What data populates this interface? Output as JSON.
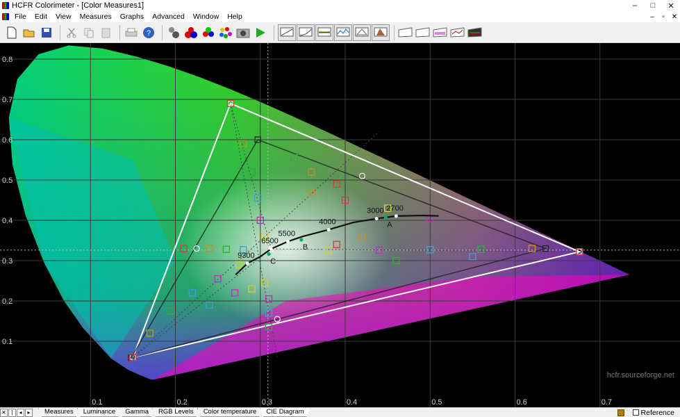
{
  "window": {
    "title": "HCFR Colorimeter - [Color Measures1]",
    "controls": [
      "–",
      "□",
      "✕"
    ],
    "mdi_controls": [
      "–",
      "▫",
      "✕"
    ]
  },
  "menu": [
    "File",
    "Edit",
    "View",
    "Measures",
    "Graphs",
    "Advanced",
    "Window",
    "Help"
  ],
  "toolbar": {
    "icons": [
      "new-icon",
      "open-icon",
      "save-icon",
      "cut-icon",
      "copy-icon",
      "paste-icon",
      "print-icon",
      "help-icon",
      "sensor-icon",
      "generator-icon",
      "rgb-balls-icon",
      "color-wheel-icon",
      "camera-icon",
      "play-icon",
      "graph-icons"
    ]
  },
  "tabs": [
    "Measures",
    "Luminance",
    "Gamma",
    "RGB Levels",
    "Color temperature",
    "CIE Diagram"
  ],
  "active_tab": "CIE Diagram",
  "reference_label": "Reference",
  "watermark": "hcfr.sourceforge.net",
  "chart_data": {
    "type": "scatter",
    "title": "",
    "xlabel": "",
    "ylabel": "",
    "xlim": [
      0.0,
      0.8
    ],
    "ylim": [
      0.0,
      0.87
    ],
    "grid": true,
    "x_ticks": [
      "0.1",
      "0.2",
      "0.3",
      "0.4",
      "0.5",
      "0.6",
      "0.7"
    ],
    "y_ticks": [
      "0.1",
      "0.2",
      "0.3",
      "0.4",
      "0.5",
      "0.6",
      "0.7",
      "0.8"
    ],
    "reference_gamut": [
      [
        0.676,
        0.322
      ],
      [
        0.265,
        0.69
      ],
      [
        0.15,
        0.06
      ]
    ],
    "measured_gamut": [
      [
        0.636,
        0.33
      ],
      [
        0.297,
        0.6
      ],
      [
        0.148,
        0.059
      ]
    ],
    "white_points": {
      "reference": [
        0.313,
        0.329
      ],
      "measured": [
        0.31,
        0.316
      ]
    },
    "blackbody_labels": [
      {
        "label": "2700",
        "x": 0.46,
        "y": 0.4106
      },
      {
        "label": "3000",
        "x": 0.4369,
        "y": 0.4041
      },
      {
        "label": "4000",
        "x": 0.3805,
        "y": 0.3768
      },
      {
        "label": "5500",
        "x": 0.3325,
        "y": 0.3475
      },
      {
        "label": "6500",
        "x": 0.3127,
        "y": 0.329
      },
      {
        "label": "9300",
        "x": 0.2848,
        "y": 0.2932
      }
    ],
    "illuminants": [
      {
        "label": "A",
        "x": 0.4476,
        "y": 0.4074
      },
      {
        "label": "B",
        "x": 0.3484,
        "y": 0.3516
      },
      {
        "label": "C",
        "x": 0.3101,
        "y": 0.3162
      }
    ],
    "saturation_points": [
      [
        0.676,
        0.322
      ],
      [
        0.62,
        0.33
      ],
      [
        0.56,
        0.328
      ],
      [
        0.5,
        0.327
      ],
      [
        0.44,
        0.326
      ],
      [
        0.38,
        0.325
      ],
      [
        0.265,
        0.69
      ],
      [
        0.28,
        0.59
      ],
      [
        0.29,
        0.52
      ],
      [
        0.297,
        0.455
      ],
      [
        0.3,
        0.4
      ],
      [
        0.305,
        0.36
      ],
      [
        0.15,
        0.06
      ],
      [
        0.17,
        0.12
      ],
      [
        0.195,
        0.175
      ],
      [
        0.22,
        0.22
      ],
      [
        0.25,
        0.255
      ],
      [
        0.275,
        0.29
      ],
      [
        0.21,
        0.33
      ],
      [
        0.24,
        0.33
      ],
      [
        0.26,
        0.328
      ],
      [
        0.28,
        0.327
      ],
      [
        0.5,
        0.405
      ],
      [
        0.45,
        0.43
      ],
      [
        0.4,
        0.45
      ],
      [
        0.36,
        0.47
      ],
      [
        0.31,
        0.135
      ],
      [
        0.31,
        0.17
      ],
      [
        0.31,
        0.205
      ],
      [
        0.305,
        0.245
      ],
      [
        0.39,
        0.49
      ],
      [
        0.36,
        0.52
      ],
      [
        0.34,
        0.555
      ],
      [
        0.24,
        0.19
      ],
      [
        0.27,
        0.22
      ],
      [
        0.29,
        0.23
      ],
      [
        0.39,
        0.34
      ],
      [
        0.42,
        0.36
      ],
      [
        0.46,
        0.3
      ],
      [
        0.55,
        0.31
      ]
    ]
  }
}
